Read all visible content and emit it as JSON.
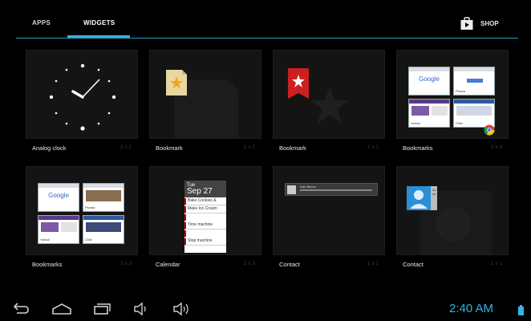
{
  "tabs": {
    "apps": "APPS",
    "widgets": "WIDGETS",
    "shop": "SHOP"
  },
  "widgets": [
    {
      "name": "Analog clock",
      "size": "2 x 2"
    },
    {
      "name": "Bookmark",
      "size": "1 x 1"
    },
    {
      "name": "Bookmark",
      "size": "1 x 1"
    },
    {
      "name": "Bookmarks",
      "size": "3 x 3"
    },
    {
      "name": "Bookmarks",
      "size": "3 x 3"
    },
    {
      "name": "Calendar",
      "size": "2 x 3"
    },
    {
      "name": "Contact",
      "size": "1 x 1"
    },
    {
      "name": "Contact",
      "size": "1 x 1"
    }
  ],
  "preview": {
    "google": "Google",
    "picasa": "Picasa",
    "yahoo": "Yahoo!",
    "cnn": "CNN",
    "calendar_day": "Tue",
    "calendar_date": "Sep 27",
    "events": [
      "Bake Cookies &",
      "Make Ice Cream",
      "Time machine",
      "Stop machine"
    ],
    "contact_name": "Dan Bevon"
  },
  "status": {
    "time": "2:40 AM"
  },
  "colors": {
    "accent": "#33b5e5",
    "bookmark_red": "#cc1f1f",
    "tile_bg": "#141414"
  },
  "icons": {
    "back": "back-arrow-icon",
    "home": "home-icon",
    "recents": "recent-apps-icon",
    "vol_down": "volume-down-icon",
    "vol_up": "volume-up-icon",
    "shop": "shopping-bag-icon",
    "battery": "battery-icon"
  }
}
